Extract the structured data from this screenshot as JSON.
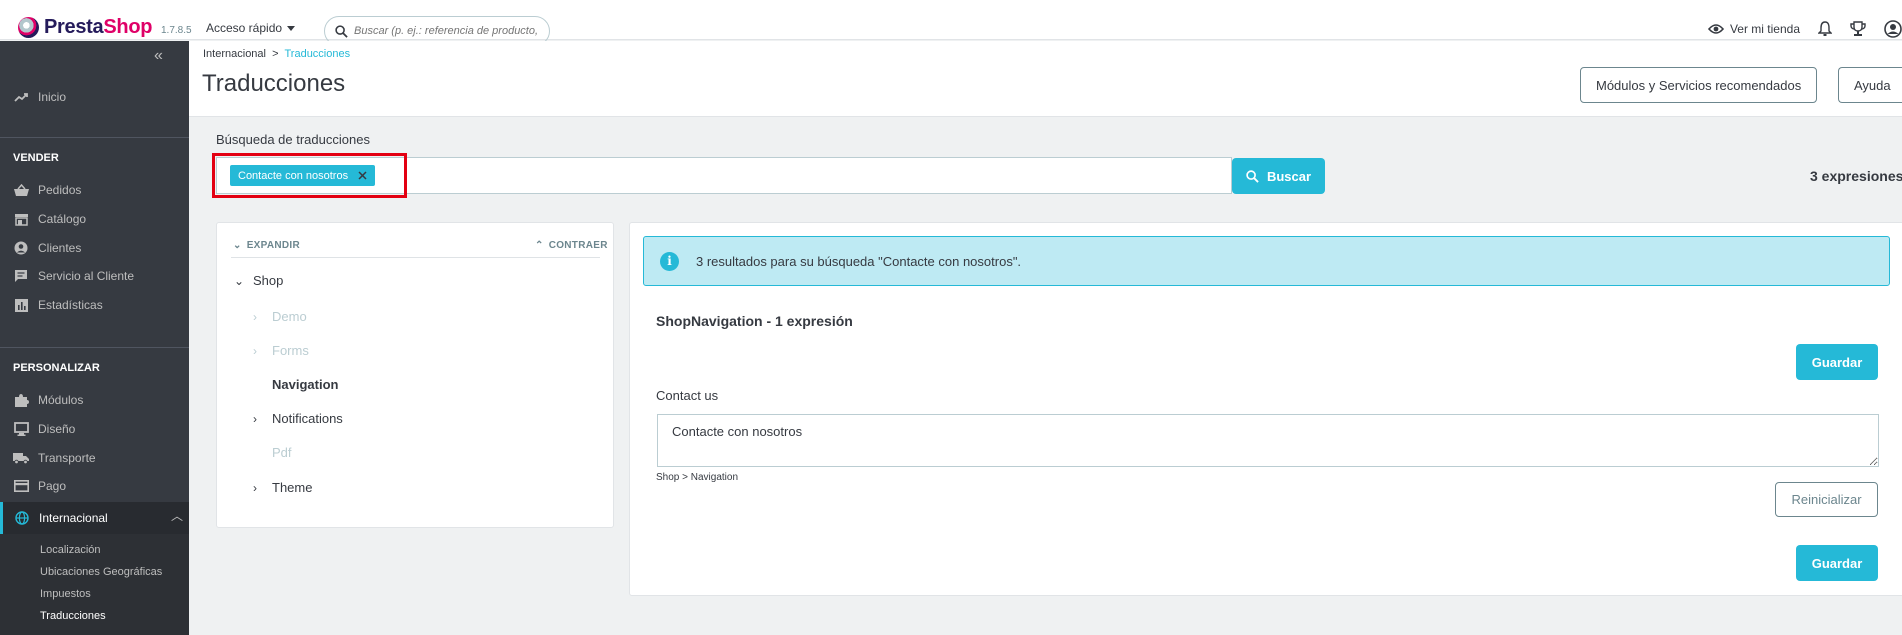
{
  "header": {
    "logo_text": "PrestaShop",
    "version": "1.7.8.5",
    "quick_access": "Acceso rápido",
    "search_placeholder": "Buscar (p. ej.: referencia de producto,",
    "view_store": "Ver mi tienda"
  },
  "sidebar": {
    "collapse_icon": "double-chevron-left",
    "home": "Inicio",
    "sections": [
      {
        "title": "VENDER",
        "items": [
          "Pedidos",
          "Catálogo",
          "Clientes",
          "Servicio al Cliente",
          "Estadísticas"
        ]
      },
      {
        "title": "PERSONALIZAR",
        "items": [
          "Módulos",
          "Diseño",
          "Transporte",
          "Pago",
          "Internacional"
        ]
      }
    ],
    "sub_items": [
      "Localización",
      "Ubicaciones Geográficas",
      "Impuestos",
      "Traducciones"
    ],
    "active_item": "Internacional",
    "active_sub": "Traducciones"
  },
  "page": {
    "breadcrumb_parent": "Internacional",
    "breadcrumb_sep": ">",
    "breadcrumb_current": "Traducciones",
    "title": "Traducciones",
    "recommended_button": "Módulos y Servicios recomendados",
    "help_button": "Ayuda"
  },
  "search": {
    "label": "Búsqueda de traducciones",
    "tag": "Contacte con nosotros",
    "button": "Buscar",
    "count": "3 expresiones"
  },
  "tree": {
    "expand": "EXPANDIR",
    "collapse": "CONTRAER",
    "root": "Shop",
    "children": [
      {
        "label": "Demo",
        "state": "disabled",
        "arrow": true
      },
      {
        "label": "Forms",
        "state": "disabled",
        "arrow": true
      },
      {
        "label": "Navigation",
        "state": "selected",
        "arrow": false
      },
      {
        "label": "Notifications",
        "state": "normal",
        "arrow": true
      },
      {
        "label": "Pdf",
        "state": "disabled",
        "arrow": false
      },
      {
        "label": "Theme",
        "state": "normal",
        "arrow": true
      }
    ]
  },
  "results": {
    "alert": "3 resultados para su búsqueda \"Contacte con nosotros\".",
    "domain_title": "ShopNavigation - 1 expresión",
    "save_label": "Guardar",
    "original": "Contact us",
    "translation": "Contacte con nosotros",
    "path": "Shop > Navigation",
    "reset_label": "Reinicializar"
  },
  "colors": {
    "primary": "#25b9d7",
    "sidebar": "#363a41",
    "highlight_box": "#e30012",
    "alert_bg": "#beeaf3"
  }
}
